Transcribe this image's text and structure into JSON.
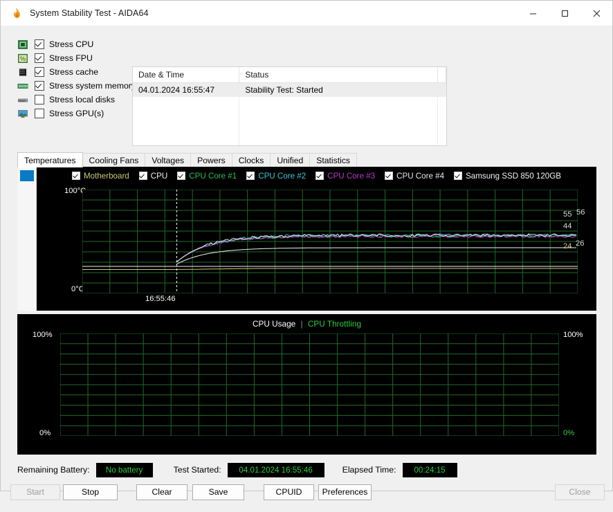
{
  "window": {
    "title": "System Stability Test - AIDA64",
    "app_icon": "flame-icon",
    "minimize": "minimize-icon",
    "maximize": "maximize-icon",
    "close": "close-icon"
  },
  "stress_options": [
    {
      "label": "Stress CPU",
      "checked": true,
      "icon": "cpu-chip-icon"
    },
    {
      "label": "Stress FPU",
      "checked": true,
      "icon": "percent-icon"
    },
    {
      "label": "Stress cache",
      "checked": true,
      "icon": "cache-chip-icon"
    },
    {
      "label": "Stress system memory",
      "checked": true,
      "icon": "memory-module-icon"
    },
    {
      "label": "Stress local disks",
      "checked": false,
      "icon": "hard-disk-icon"
    },
    {
      "label": "Stress GPU(s)",
      "checked": false,
      "icon": "gpu-monitor-icon"
    }
  ],
  "log": {
    "columns": [
      "Date & Time",
      "Status"
    ],
    "rows": [
      {
        "datetime": "04.01.2024 16:55:47",
        "status": "Stability Test: Started"
      }
    ],
    "empty_rows": 4
  },
  "tabs": [
    {
      "label": "Temperatures",
      "active": true
    },
    {
      "label": "Cooling Fans",
      "active": false
    },
    {
      "label": "Voltages",
      "active": false
    },
    {
      "label": "Powers",
      "active": false
    },
    {
      "label": "Clocks",
      "active": false
    },
    {
      "label": "Unified",
      "active": false
    },
    {
      "label": "Statistics",
      "active": false
    }
  ],
  "temp_chart": {
    "legend": [
      {
        "label": "Motherboard",
        "color": "#cfc87a",
        "checked": true
      },
      {
        "label": "CPU",
        "color": "#f2f2f2",
        "checked": true
      },
      {
        "label": "CPU Core #1",
        "color": "#2fbf5a",
        "checked": true
      },
      {
        "label": "CPU Core #2",
        "color": "#3fc8d8",
        "checked": true
      },
      {
        "label": "CPU Core #3",
        "color": "#b838c8",
        "checked": true
      },
      {
        "label": "CPU Core #4",
        "color": "#e8e8e8",
        "checked": true
      },
      {
        "label": "Samsung SSD 850 120GB",
        "color": "#f2f2f2",
        "checked": true
      }
    ],
    "y_top": "100°C",
    "y_bottom": "0°C",
    "x_tick": "16:55:46",
    "right_values": [
      {
        "text": "55",
        "color": "#dcdcdc"
      },
      {
        "text": "56",
        "color": "#dcdcdc"
      },
      {
        "text": "44",
        "color": "#dcdcdc"
      },
      {
        "text": "24",
        "color": "#cfc87a"
      },
      {
        "text": "26",
        "color": "#dcdcdc"
      }
    ],
    "grid_color": "#1f6b2f",
    "bg_color": "#000000"
  },
  "cpu_chart": {
    "title_usage": "CPU Usage",
    "title_sep": "|",
    "title_throttling": "CPU Throttling",
    "left_top": "100%",
    "left_bottom": "0%",
    "right_top": "100%",
    "right_bottom": "0%",
    "usage_color": "#ffffff",
    "throttling_color": "#2ecc40",
    "grid_color": "#1f6b2f"
  },
  "chart_data": [
    {
      "type": "line",
      "title": "Temperatures",
      "xlabel": "",
      "ylabel": "°C",
      "ylim": [
        0,
        100
      ],
      "x_ticks": [
        "16:55:46"
      ],
      "y_ticks": [
        "0°C",
        "100°C"
      ],
      "grid": true,
      "legend_position": "top",
      "series": [
        {
          "name": "Motherboard",
          "color": "#cfc87a",
          "current": 24,
          "start": 23,
          "plateau": 24
        },
        {
          "name": "CPU",
          "color": "#f2f2f2",
          "current": 44,
          "start": 28,
          "plateau": 44
        },
        {
          "name": "CPU Core #1",
          "color": "#2fbf5a",
          "current": 55,
          "start": 30,
          "plateau": 55
        },
        {
          "name": "CPU Core #2",
          "color": "#3fc8d8",
          "current": 56,
          "start": 30,
          "plateau": 56
        },
        {
          "name": "CPU Core #3",
          "color": "#b838c8",
          "current": 55,
          "start": 30,
          "plateau": 55
        },
        {
          "name": "CPU Core #4",
          "color": "#e8e8e8",
          "current": 56,
          "start": 30,
          "plateau": 56
        },
        {
          "name": "Samsung SSD 850 120GB",
          "color": "#f2f2f2",
          "current": 26,
          "start": 26,
          "plateau": 26
        }
      ]
    },
    {
      "type": "line",
      "title": "CPU Usage | CPU Throttling",
      "xlabel": "",
      "ylabel": "%",
      "ylim": [
        0,
        100
      ],
      "y_ticks": [
        "0%",
        "100%"
      ],
      "grid": true,
      "legend_position": "top",
      "series": [
        {
          "name": "CPU Usage",
          "color": "#ffffff",
          "values": []
        },
        {
          "name": "CPU Throttling",
          "color": "#2ecc40",
          "values": []
        }
      ]
    }
  ],
  "status": {
    "battery_label": "Remaining Battery:",
    "battery_value": "No battery",
    "started_label": "Test Started:",
    "started_value": "04.01.2024 16:55:46",
    "elapsed_label": "Elapsed Time:",
    "elapsed_value": "00:24:15"
  },
  "buttons": [
    {
      "label": "Start",
      "disabled": true
    },
    {
      "label": "Stop",
      "disabled": false
    },
    {
      "label": "Clear",
      "disabled": false
    },
    {
      "label": "Save",
      "disabled": false
    },
    {
      "label": "CPUID",
      "disabled": false
    },
    {
      "label": "Preferences",
      "disabled": false
    },
    {
      "label": "Close",
      "disabled": true
    }
  ]
}
